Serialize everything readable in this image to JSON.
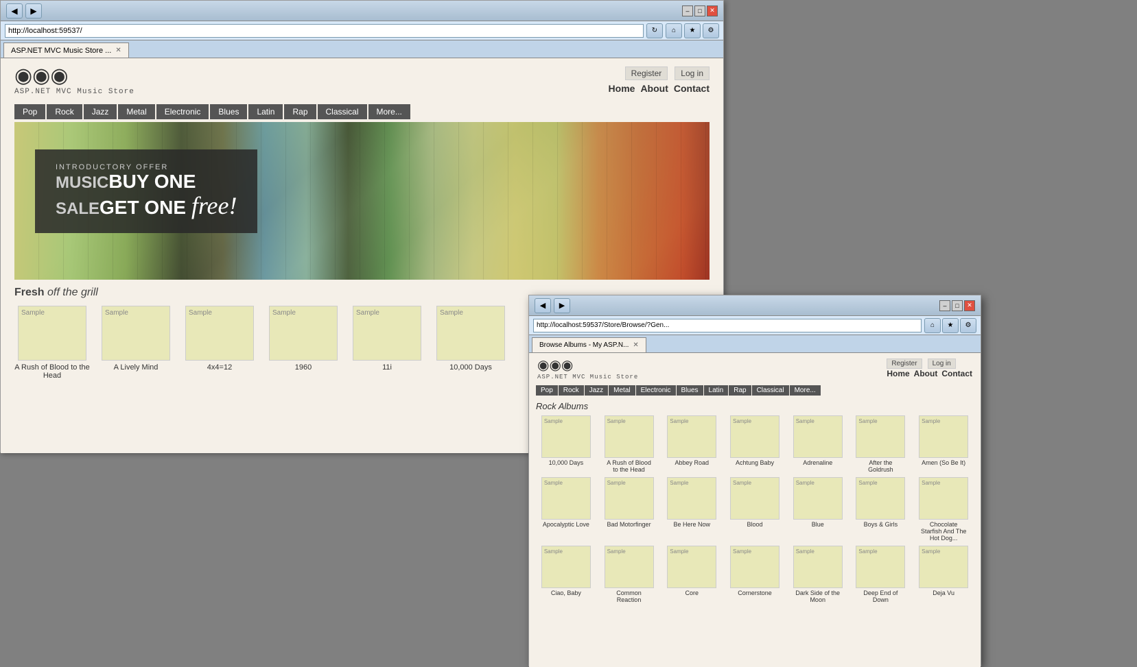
{
  "window1": {
    "title": "ASP.NET MVC Music Store ...",
    "url": "http://localhost:59537/",
    "auth": {
      "register": "Register",
      "login": "Log in"
    },
    "nav": {
      "home": "Home",
      "about": "About",
      "contact": "Contact"
    },
    "genres": [
      "Pop",
      "Rock",
      "Jazz",
      "Metal",
      "Electronic",
      "Blues",
      "Latin",
      "Rap",
      "Classical",
      "More..."
    ],
    "hero": {
      "intro": "INTRODUCTORY OFFER",
      "line1_prefix": "MUSIC",
      "line1_suffix": "BUY ONE",
      "line2_prefix": "SALE",
      "line2_suffix": "GET ONE",
      "line2_cursive": "free!"
    },
    "fresh": {
      "bold": "Fresh",
      "italic": "off the grill"
    },
    "albums": [
      {
        "label": "Sample",
        "name": "A Rush of Blood to the Head"
      },
      {
        "label": "Sample",
        "name": "A Lively Mind"
      },
      {
        "label": "Sample",
        "name": "4x4=12"
      },
      {
        "label": "Sample",
        "name": "1960"
      },
      {
        "label": "Sample",
        "name": "11i"
      },
      {
        "label": "Sample",
        "name": "10,000 Days"
      }
    ]
  },
  "window2": {
    "title": "Browse Albums - My ASP.N...",
    "url": "http://localhost:59537/Store/Browse/?Gen...",
    "auth": {
      "register": "Register",
      "login": "Log in"
    },
    "nav": {
      "home": "Home",
      "about": "About",
      "contact": "Contact"
    },
    "genres": [
      "Pop",
      "Rock",
      "Jazz",
      "Metal",
      "Electronic",
      "Blues",
      "Latin",
      "Rap",
      "Classical",
      "More..."
    ],
    "sectionTitle": "Rock Albums",
    "albumRows": [
      [
        {
          "label": "Sample",
          "name": "10,000 Days"
        },
        {
          "label": "Sample",
          "name": "A Rush of Blood to the Head"
        },
        {
          "label": "Sample",
          "name": "Abbey Road"
        },
        {
          "label": "Sample",
          "name": "Achtung Baby"
        },
        {
          "label": "Sample",
          "name": "Adrenaline"
        },
        {
          "label": "Sample",
          "name": "After the Goldrush"
        },
        {
          "label": "Sample",
          "name": "Amen (So Be It)"
        }
      ],
      [
        {
          "label": "Sample",
          "name": "Apocalyptic Love"
        },
        {
          "label": "Sample",
          "name": "Bad Motorfinger"
        },
        {
          "label": "Sample",
          "name": "Be Here Now"
        },
        {
          "label": "Sample",
          "name": "Blood"
        },
        {
          "label": "Sample",
          "name": "Blue"
        },
        {
          "label": "Sample",
          "name": "Boys & Girls"
        },
        {
          "label": "Sample",
          "name": "Chocolate Starfish And The Hot Dog..."
        }
      ],
      [
        {
          "label": "Sample",
          "name": "Ciao, Baby"
        },
        {
          "label": "Sample",
          "name": "Common Reaction"
        },
        {
          "label": "Sample",
          "name": "Core"
        },
        {
          "label": "Sample",
          "name": "Cornerstone"
        },
        {
          "label": "Sample",
          "name": "Dark Side of the Moon"
        },
        {
          "label": "Sample",
          "name": "Deep End of Down"
        },
        {
          "label": "Sample",
          "name": "Deja Vu"
        }
      ]
    ]
  }
}
